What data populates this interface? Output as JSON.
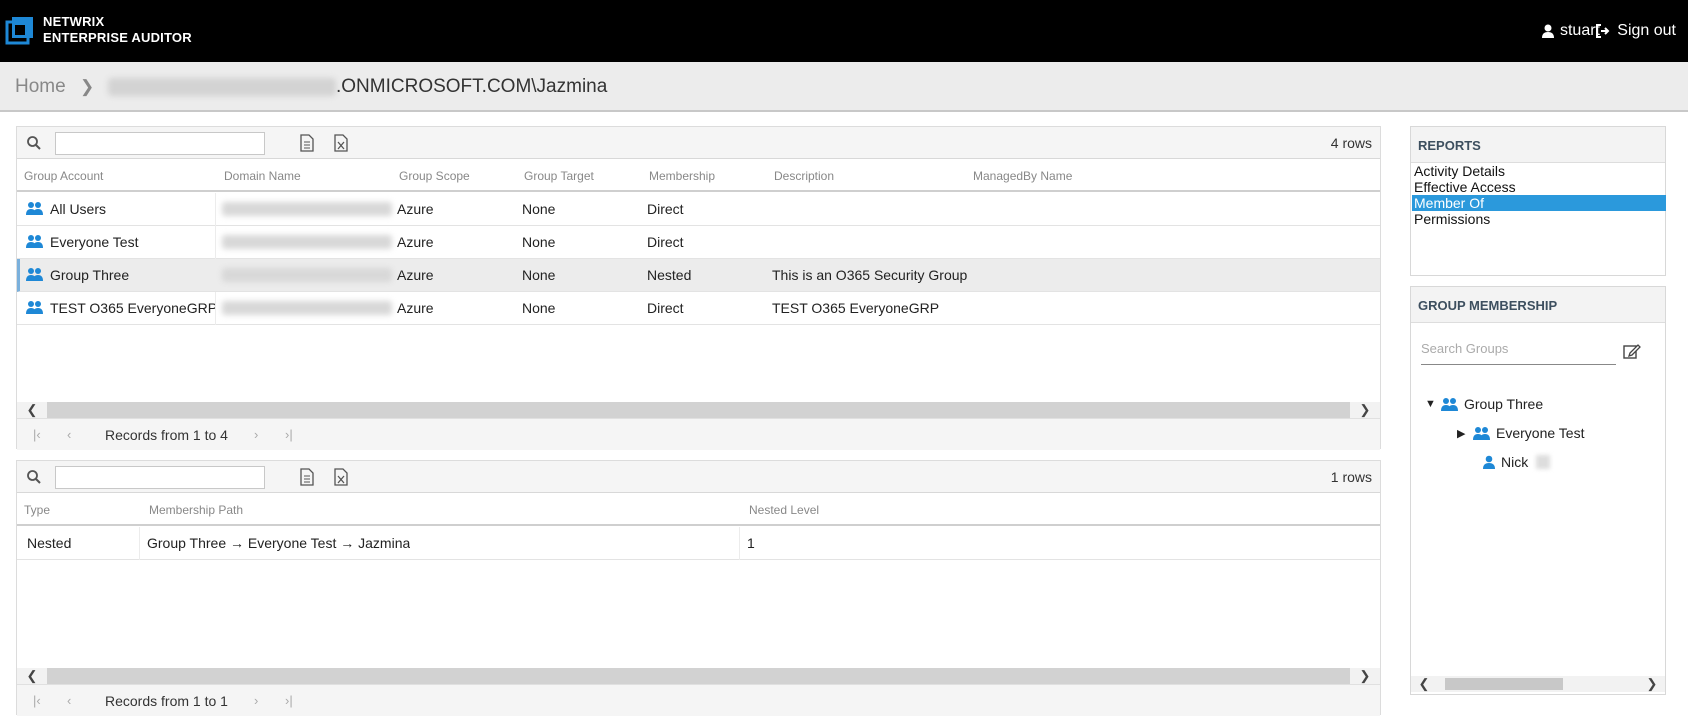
{
  "app": {
    "brand_line1": "NETWRIX",
    "brand_line2": "ENTERPRISE AUDITOR",
    "user_name": "stuart",
    "signout_label": "Sign out"
  },
  "breadcrumb": {
    "home": "Home",
    "path_visible": ".ONMICROSOFT.COM\\Jazmina"
  },
  "groups_grid": {
    "rows_count": "4 rows",
    "columns": [
      "Group Account",
      "Domain Name",
      "Group Scope",
      "Group Target",
      "Membership",
      "Description",
      "ManagedBy Name"
    ],
    "rows": [
      {
        "account": "All Users",
        "scope": "Azure",
        "target": "None",
        "membership": "Direct",
        "description": ""
      },
      {
        "account": "Everyone Test",
        "scope": "Azure",
        "target": "None",
        "membership": "Direct",
        "description": ""
      },
      {
        "account": "Group Three",
        "scope": "Azure",
        "target": "None",
        "membership": "Nested",
        "description": "This is an O365 Security Group"
      },
      {
        "account": "TEST O365 EveryoneGRP",
        "scope": "Azure",
        "target": "None",
        "membership": "Direct",
        "description": "TEST O365 EveryoneGRP"
      }
    ],
    "selected_row": 2,
    "pager_label": "Records from 1 to 4"
  },
  "path_grid": {
    "rows_count": "1 rows",
    "columns": [
      "Type",
      "Membership Path",
      "Nested Level"
    ],
    "rows": [
      {
        "type": "Nested",
        "path": "Group Three → Everyone Test → Jazmina",
        "level": "1"
      }
    ],
    "pager_label": "Records from 1 to 1"
  },
  "reports": {
    "title": "REPORTS",
    "items": [
      "Activity Details",
      "Effective Access",
      "Member Of",
      "Permissions"
    ],
    "active_index": 2
  },
  "group_membership": {
    "title": "GROUP MEMBERSHIP",
    "search_placeholder": "Search Groups",
    "tree": [
      {
        "label": "Group Three",
        "icon": "group-icon",
        "state": "expanded"
      },
      {
        "label": "Everyone Test",
        "icon": "group-icon",
        "state": "collapsed"
      },
      {
        "label": "Nick",
        "icon": "user-icon",
        "state": "leaf"
      }
    ]
  },
  "colors": {
    "accent": "#2b99dc",
    "icon_blue": "#1e88d6",
    "topbar": "#000000"
  }
}
